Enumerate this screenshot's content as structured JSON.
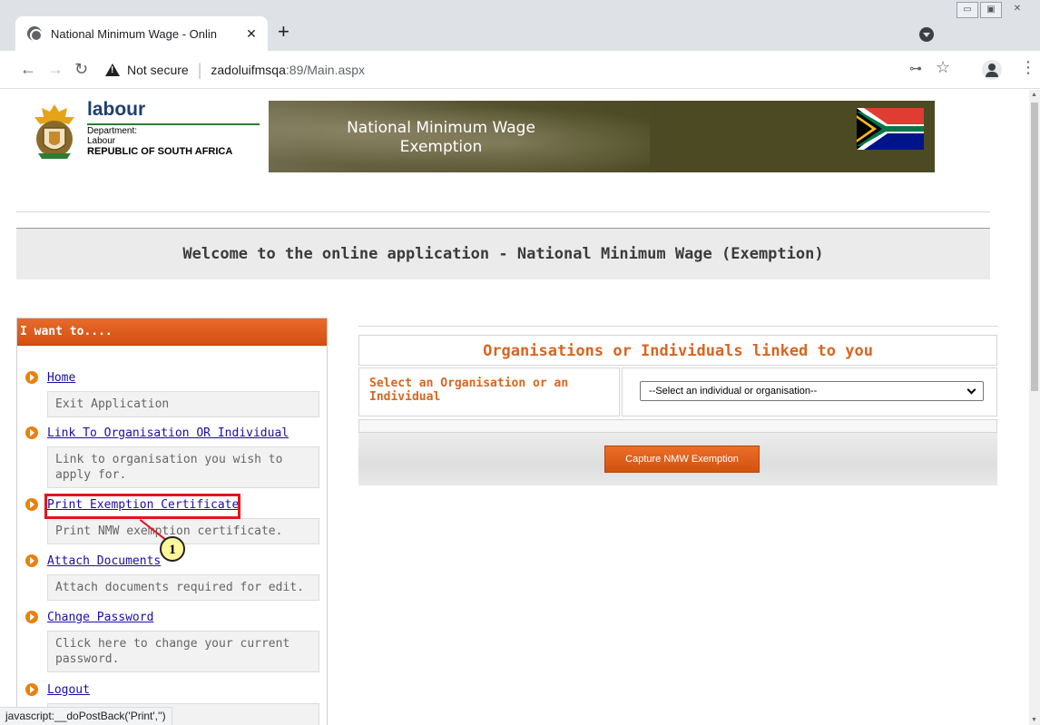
{
  "browser": {
    "tab_title": "National Minimum Wage - Onlin",
    "tab_close": "✕",
    "new_tab": "+",
    "security_label": "Not secure",
    "url_host": "zadoluifmsqa",
    "url_path": ":89/Main.aspx",
    "status_url": "javascript:__doPostBack('Print','')"
  },
  "header": {
    "brand_name": "labour",
    "dept_line": "Department:",
    "dept_name": "Labour",
    "country": "REPUBLIC OF SOUTH AFRICA",
    "banner_title": "National Minimum Wage Exemption"
  },
  "welcome": {
    "text": "Welcome to the online application - National Minimum Wage (Exemption)"
  },
  "menu": {
    "title": "I want to....",
    "items": [
      {
        "label": "Home",
        "description": "Exit Application"
      },
      {
        "label": "Link To Organisation OR Individual",
        "description": "Link to organisation you wish to apply for."
      },
      {
        "label": "Print Exemption Certificate",
        "description": "Print NMW exemption certificate."
      },
      {
        "label": "Attach Documents",
        "description": "Attach documents required for edit."
      },
      {
        "label": "Change Password",
        "description": "Click here to change your current password."
      },
      {
        "label": "Logout",
        "description": ""
      }
    ]
  },
  "annotation": {
    "step": "1"
  },
  "org_panel": {
    "title": "Organisations or Individuals linked to you",
    "select_label": "Select an Organisation or an Individual",
    "select_value": "--Select an individual or organisation--",
    "capture_button": "Capture NMW Exemption"
  },
  "colors": {
    "accent_orange": "#d9651f",
    "menu_header": "#e05d1c",
    "banner_olive": "#4b4a23",
    "highlight_red": "#e8131a"
  }
}
